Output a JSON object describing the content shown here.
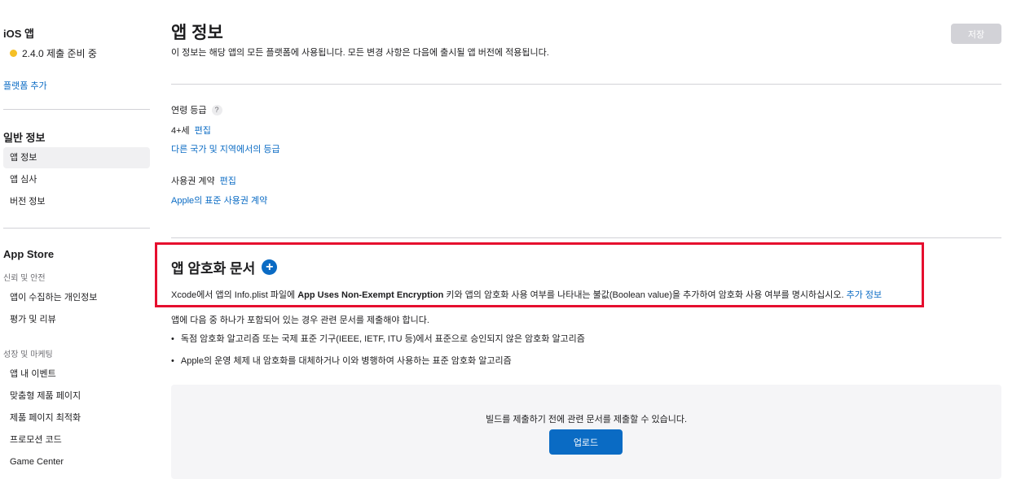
{
  "sidebar": {
    "platform_title": "iOS 앱",
    "version_status": "2.4.0 제출 준비 중",
    "add_platform": "플랫폼 추가",
    "general_section": "일반 정보",
    "general_items": [
      "앱 정보",
      "앱 심사",
      "버전 정보"
    ],
    "appstore_section": "App Store",
    "trust_subsection": "신뢰 및 안전",
    "trust_items": [
      "앱이 수집하는 개인정보",
      "평가 및 리뷰"
    ],
    "growth_subsection": "성장 및 마케팅",
    "growth_items": [
      "앱 내 이벤트",
      "맞춤형 제품 페이지",
      "제품 페이지 최적화",
      "프로모션 코드",
      "Game Center"
    ]
  },
  "main": {
    "title": "앱 정보",
    "subtitle": "이 정보는 해당 앱의 모든 플랫폼에 사용됩니다. 모든 변경 사항은 다음에 출시될 앱 버전에 적용됩니다.",
    "save_label": "저장",
    "age_rating_label": "연령 등급",
    "help_glyph": "?",
    "age_rating_value": "4+세",
    "edit_label": "편집",
    "other_regions_link": "다른 국가 및 지역에서의 등급",
    "license_label": "사용권 계약",
    "license_link": "Apple의 표준 사용권 계약",
    "encryption": {
      "title": "앱 암호화 문서",
      "desc_pre": "Xcode에서 앱의 Info.plist 파일에 ",
      "desc_bold": "App Uses Non-Exempt Encryption",
      "desc_post": " 키와 앱의 암호화 사용 여부를 나타내는 불값(Boolean value)을 추가하여 암호화 사용 여부를 명시하십시오. ",
      "more_link": "추가 정보",
      "intro": "앱에 다음 중 하나가 포함되어 있는 경우 관련 문서를 제출해야 합니다.",
      "bullets": [
        "독점 암호화 알고리즘 또는 국제 표준 기구(IEEE, IETF, ITU 등)에서 표준으로 승인되지 않은 암호화 알고리즘",
        "Apple의 운영 체제 내 암호화를 대체하거나 이와 병행하여 사용하는 표준 암호화 알고리즘"
      ],
      "upload_text": "빌드를 제출하기 전에 관련 문서를 제출할 수 있습니다.",
      "upload_label": "업로드"
    }
  },
  "colors": {
    "link": "#0a6bc4",
    "highlight": "#e60e2e",
    "status_dot": "#f5c026"
  }
}
